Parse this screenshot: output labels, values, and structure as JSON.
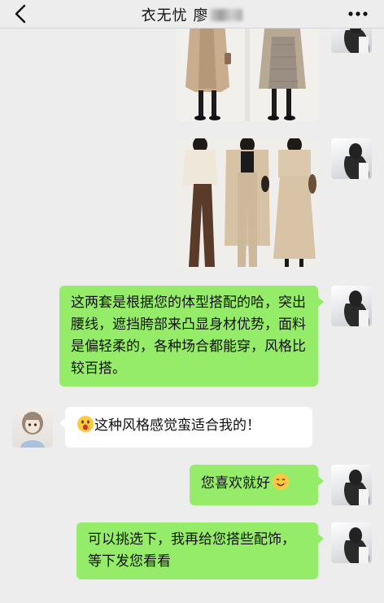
{
  "header": {
    "title": "衣无忧 廖"
  },
  "icons": {
    "back": "chevron-left-icon",
    "more": "more-dots-icon",
    "emoji_surprised": "surprised-face-icon",
    "emoji_smile": "smiling-face-icon"
  },
  "messages": [
    {
      "from": "me",
      "type": "image",
      "content": "outfit-photo-1"
    },
    {
      "from": "me",
      "type": "image",
      "content": "outfit-photo-2"
    },
    {
      "from": "me",
      "type": "text",
      "text": "这两套是根据您的体型搭配的哈，突出腰线，遮挡胯部来凸显身材优势，面料是偏轻柔的，各种场合都能穿，风格比较百搭。"
    },
    {
      "from": "other",
      "type": "text",
      "text": "这种风格感觉蛮适合我的！"
    },
    {
      "from": "me",
      "type": "text",
      "text": "您喜欢就好"
    },
    {
      "from": "me",
      "type": "text",
      "text": "可以挑选下，我再给您搭些配饰，等下发您看看"
    }
  ],
  "colors": {
    "bubble_me": "#95ec69",
    "bubble_other": "#ffffff",
    "background": "#ededed"
  }
}
